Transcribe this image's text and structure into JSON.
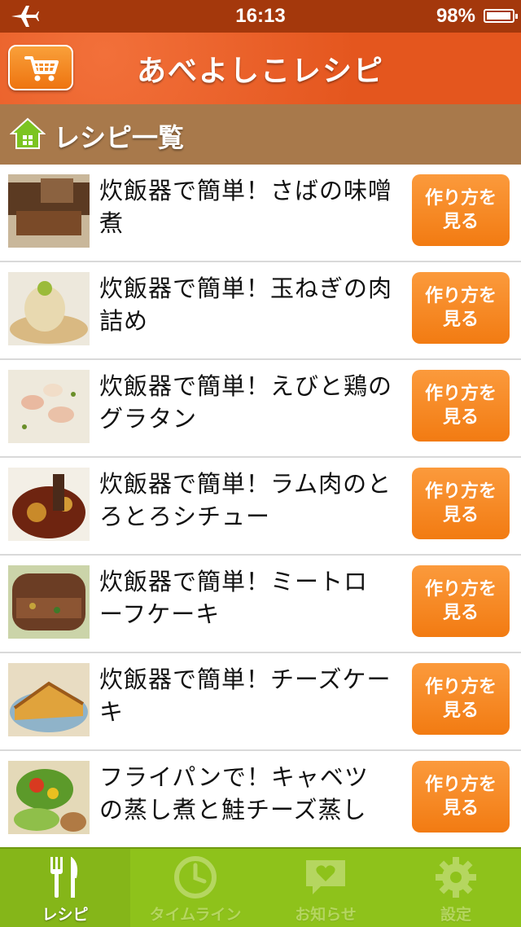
{
  "status_bar": {
    "time": "16:13",
    "battery": "98%",
    "battery_level": 0.98
  },
  "nav": {
    "title": "あべよしこレシピ"
  },
  "section": {
    "title": "レシピ一覧"
  },
  "recipes": [
    {
      "title": "炊飯器で簡単！さばの味噌煮",
      "button": "作り方を見る"
    },
    {
      "title": "炊飯器で簡単！玉ねぎの肉詰め",
      "button": "作り方を見る"
    },
    {
      "title": "炊飯器で簡単！えびと鶏のグラタン",
      "button": "作り方を見る"
    },
    {
      "title": "炊飯器で簡単！ラム肉のとろとろシチュー",
      "button": "作り方を見る"
    },
    {
      "title": "炊飯器で簡単！ミートローフケーキ",
      "button": "作り方を見る"
    },
    {
      "title": "炊飯器で簡単！チーズケーキ",
      "button": "作り方を見る"
    },
    {
      "title": "フライパンで！キャベツの蒸し煮と鮭チーズ蒸し",
      "button": "作り方を見る"
    }
  ],
  "tabs": [
    {
      "label": "レシピ",
      "icon": "fork-knife-icon",
      "active": true
    },
    {
      "label": "タイムライン",
      "icon": "clock-icon",
      "active": false
    },
    {
      "label": "お知らせ",
      "icon": "heart-message-icon",
      "active": false
    },
    {
      "label": "設定",
      "icon": "gear-icon",
      "active": false
    }
  ],
  "colors": {
    "nav": "#e4571f",
    "section": "#a8794b",
    "button": "#f27b12",
    "tabbar": "#8ec21b"
  }
}
